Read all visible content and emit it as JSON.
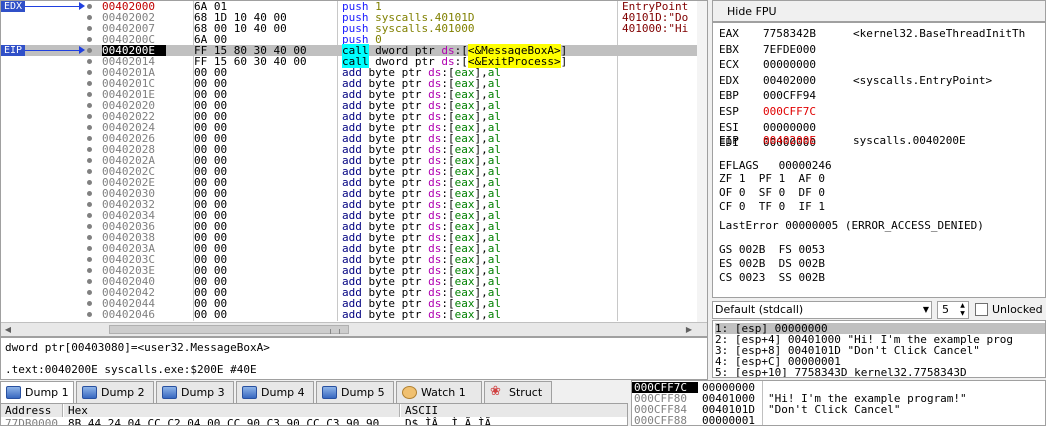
{
  "disasm": {
    "rows": [
      {
        "label": "EDX",
        "addr": "00402000",
        "bytes": "6A 01",
        "instr": [
          [
            "push",
            "kw-push"
          ],
          [
            " 1",
            "kw-imm"
          ]
        ],
        "cmt": "EntryPoint",
        "addrRed": true
      },
      {
        "label": "",
        "addr": "00402002",
        "bytes": "68 1D 10 40 00",
        "instr": [
          [
            "push",
            "kw-push"
          ],
          [
            " syscalls.40101D",
            "kw-imm"
          ]
        ],
        "cmt": "40101D:\"Do"
      },
      {
        "label": "",
        "addr": "00402007",
        "bytes": "68 00 10 40 00",
        "instr": [
          [
            "push",
            "kw-push"
          ],
          [
            " syscalls.401000",
            "kw-imm"
          ]
        ],
        "cmt": "401000:\"Hi"
      },
      {
        "label": "",
        "addr": "0040200C",
        "bytes": "6A 00",
        "instr": [
          [
            "push",
            "kw-push"
          ],
          [
            " 0",
            "kw-imm"
          ]
        ],
        "cmt": ""
      },
      {
        "label": "EIP",
        "addr": "0040200E",
        "bytes": "FF 15 80 30 40 00",
        "instr": [
          [
            "call",
            "kw-call"
          ],
          [
            " dword ptr ",
            "kw-txt"
          ],
          [
            "ds",
            "kw-ds"
          ],
          [
            ":[",
            "kw-txt"
          ],
          [
            "<&MessageBoxA>",
            "kw-api"
          ],
          [
            "]",
            "kw-txt"
          ]
        ],
        "cmt": "",
        "cur": true,
        "eip": true
      },
      {
        "label": "",
        "addr": "00402014",
        "bytes": "FF 15 60 30 40 00",
        "instr": [
          [
            "call",
            "kw-call"
          ],
          [
            " dword ptr ",
            "kw-txt"
          ],
          [
            "ds",
            "kw-ds"
          ],
          [
            ":[",
            "kw-txt"
          ],
          [
            "<&ExitProcess>",
            "kw-api"
          ],
          [
            "]",
            "kw-txt"
          ]
        ],
        "cmt": ""
      },
      {
        "label": "",
        "addr": "0040201A",
        "bytes": "00 00",
        "add": true
      },
      {
        "label": "",
        "addr": "0040201C",
        "bytes": "00 00",
        "add": true
      },
      {
        "label": "",
        "addr": "0040201E",
        "bytes": "00 00",
        "add": true
      },
      {
        "label": "",
        "addr": "00402020",
        "bytes": "00 00",
        "add": true
      },
      {
        "label": "",
        "addr": "00402022",
        "bytes": "00 00",
        "add": true
      },
      {
        "label": "",
        "addr": "00402024",
        "bytes": "00 00",
        "add": true
      },
      {
        "label": "",
        "addr": "00402026",
        "bytes": "00 00",
        "add": true
      },
      {
        "label": "",
        "addr": "00402028",
        "bytes": "00 00",
        "add": true
      },
      {
        "label": "",
        "addr": "0040202A",
        "bytes": "00 00",
        "add": true
      },
      {
        "label": "",
        "addr": "0040202C",
        "bytes": "00 00",
        "add": true
      },
      {
        "label": "",
        "addr": "0040202E",
        "bytes": "00 00",
        "add": true
      },
      {
        "label": "",
        "addr": "00402030",
        "bytes": "00 00",
        "add": true
      },
      {
        "label": "",
        "addr": "00402032",
        "bytes": "00 00",
        "add": true
      },
      {
        "label": "",
        "addr": "00402034",
        "bytes": "00 00",
        "add": true
      },
      {
        "label": "",
        "addr": "00402036",
        "bytes": "00 00",
        "add": true
      },
      {
        "label": "",
        "addr": "00402038",
        "bytes": "00 00",
        "add": true
      },
      {
        "label": "",
        "addr": "0040203A",
        "bytes": "00 00",
        "add": true
      },
      {
        "label": "",
        "addr": "0040203C",
        "bytes": "00 00",
        "add": true
      },
      {
        "label": "",
        "addr": "0040203E",
        "bytes": "00 00",
        "add": true
      },
      {
        "label": "",
        "addr": "00402040",
        "bytes": "00 00",
        "add": true
      },
      {
        "label": "",
        "addr": "00402042",
        "bytes": "00 00",
        "add": true
      },
      {
        "label": "",
        "addr": "00402044",
        "bytes": "00 00",
        "add": true
      },
      {
        "label": "",
        "addr": "00402046",
        "bytes": "00 00",
        "add": true
      }
    ],
    "add_instr": [
      [
        "add",
        "kw-add"
      ],
      [
        " byte ptr ",
        "kw-txt"
      ],
      [
        "ds",
        "kw-ds"
      ],
      [
        ":[",
        "kw-txt"
      ],
      [
        "eax",
        "kw-reg"
      ],
      [
        "],",
        "kw-txt"
      ],
      [
        "al",
        "kw-reg"
      ]
    ]
  },
  "info": {
    "line1": "dword ptr[00403080]=<user32.MessageBoxA>",
    "line2": ".text:0040200E syscalls.exe:$200E #40E"
  },
  "regs": {
    "hide_fpu_label": "Hide FPU",
    "gp": [
      {
        "n": "EAX",
        "v": "7758342B",
        "d": "<kernel32.BaseThreadInitTh"
      },
      {
        "n": "EBX",
        "v": "7EFDE000",
        "d": ""
      },
      {
        "n": "ECX",
        "v": "00000000",
        "d": ""
      },
      {
        "n": "EDX",
        "v": "00402000",
        "d": "<syscalls.EntryPoint>"
      },
      {
        "n": "EBP",
        "v": "000CFF94",
        "d": ""
      },
      {
        "n": "ESP",
        "v": "000CFF7C",
        "d": "",
        "red": true
      },
      {
        "n": "ESI",
        "v": "00000000",
        "d": ""
      },
      {
        "n": "EDI",
        "v": "00000000",
        "d": ""
      }
    ],
    "eip": {
      "n": "EIP",
      "v": "0040200E",
      "d": "syscalls.0040200E",
      "red": true
    },
    "eflags": "EFLAGS   00000246",
    "flags": [
      "ZF 1  PF 1  AF 0",
      "OF 0  SF 0  DF 0",
      "CF 0  TF 0  IF 1"
    ],
    "lasterror": "LastError 00000005 (ERROR_ACCESS_DENIED)",
    "segs": [
      "GS 002B  FS 0053",
      "ES 002B  DS 002B",
      "CS 0023  SS 002B"
    ]
  },
  "callconv": {
    "selected": "Default (stdcall)",
    "count": "5",
    "unlocked_label": "Unlocked"
  },
  "args": [
    "1: [esp] 00000000",
    "2: [esp+4] 00401000 \"Hi! I'm the example prog",
    "3: [esp+8] 0040101D \"Don't Click Cancel\"",
    "4: [esp+C] 00000001",
    "5: [esp+10] 7758343D kernel32.7758343D"
  ],
  "tabs": [
    {
      "label": "Dump 1",
      "icon": "dump",
      "active": true
    },
    {
      "label": "Dump 2",
      "icon": "dump"
    },
    {
      "label": "Dump 3",
      "icon": "dump"
    },
    {
      "label": "Dump 4",
      "icon": "dump"
    },
    {
      "label": "Dump 5",
      "icon": "dump"
    },
    {
      "label": "Watch 1",
      "icon": "watch"
    },
    {
      "label": "Struct",
      "icon": "struct"
    }
  ],
  "dump": {
    "h_address": "Address",
    "h_hex": "Hex",
    "h_ascii": "ASCII",
    "row_addr": "77DB0000",
    "row_hex": "8B 44 24 04 CC C2 04 00 CC 90 C3 90 CC C3 90 90",
    "row_ascii": "D$.ÌÂ..Ì.Ã.ÌÃ.."
  },
  "stack": [
    {
      "a": "000CFF7C",
      "v": "00000000",
      "c": "",
      "top": true
    },
    {
      "a": "000CFF80",
      "v": "00401000",
      "c": "\"Hi! I'm the example program!\""
    },
    {
      "a": "000CFF84",
      "v": "0040101D",
      "c": "\"Don't Click Cancel\""
    },
    {
      "a": "000CFF88",
      "v": "00000001",
      "c": ""
    }
  ]
}
